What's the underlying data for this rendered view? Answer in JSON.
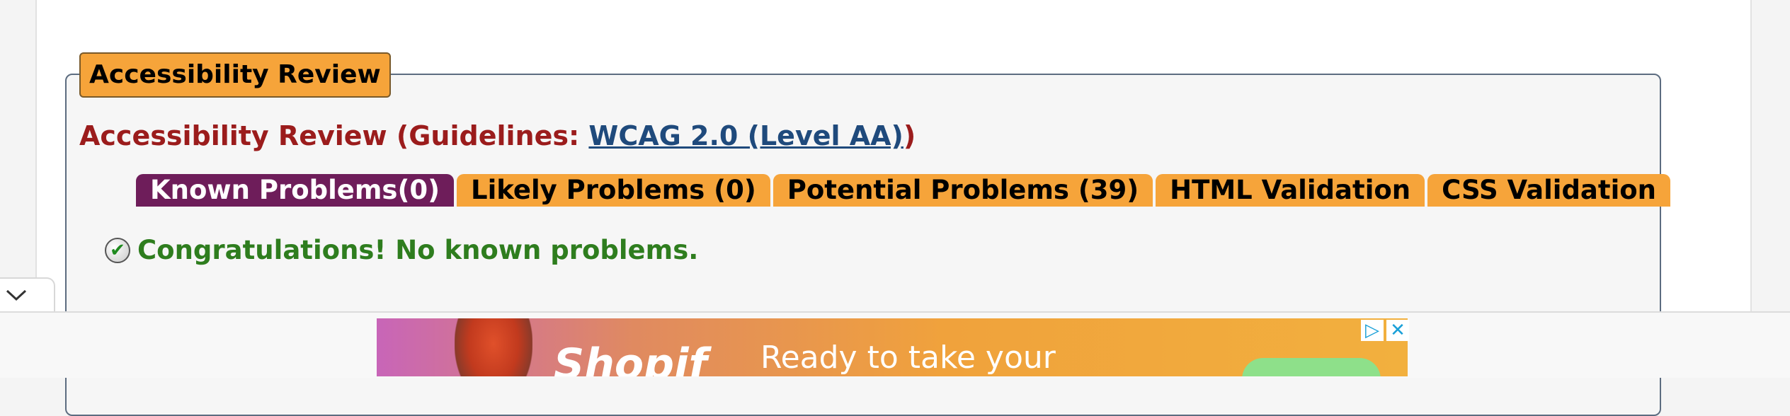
{
  "section": {
    "legend": "Accessibility Review",
    "heading_prefix": "Accessibility Review (Guidelines: ",
    "guidelines_link": "WCAG 2.0 (Level AA)",
    "heading_suffix": ")"
  },
  "tabs": [
    {
      "label": "Known Problems(0)",
      "active": true
    },
    {
      "label": "Likely Problems (0)",
      "active": false
    },
    {
      "label": "Potential Problems (39)",
      "active": false
    },
    {
      "label": "HTML Validation",
      "active": false
    },
    {
      "label": "CSS Validation",
      "active": false
    }
  ],
  "result": {
    "message": "Congratulations! No known problems."
  },
  "ad": {
    "brand_partial": "Shopif",
    "text_partial": "Ready to take your",
    "choices_icon": "▷",
    "close_icon": "✕"
  },
  "colors": {
    "tab_orange": "#f6a43a",
    "tab_active": "#6e1d5a",
    "heading_red": "#9b1c1c",
    "link_blue": "#1f4a7c",
    "success_green": "#2e7d1e"
  }
}
